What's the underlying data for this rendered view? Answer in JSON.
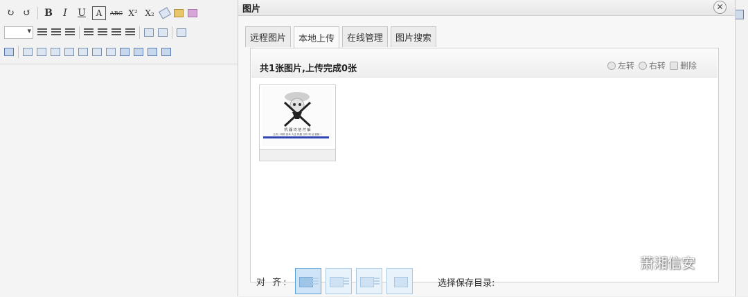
{
  "toolbar": {
    "row1": [
      {
        "name": "redo-icon",
        "glyph": "↻"
      },
      {
        "name": "undo-icon",
        "glyph": "↺"
      },
      {
        "name": "bold-icon",
        "glyph": "B"
      },
      {
        "name": "italic-icon",
        "glyph": "I"
      },
      {
        "name": "underline-icon",
        "glyph": "U"
      },
      {
        "name": "fontborder-icon",
        "glyph": "A"
      },
      {
        "name": "strikethrough-icon",
        "glyph": "ABC"
      },
      {
        "name": "superscript-icon",
        "glyph": "X²"
      },
      {
        "name": "subscript-icon",
        "glyph": "X₂"
      }
    ]
  },
  "dialog": {
    "title": "图片",
    "close_glyph": "✕",
    "tabs": [
      {
        "label": "远程图片"
      },
      {
        "label": "本地上传"
      },
      {
        "label": "在线管理"
      },
      {
        "label": "图片搜索"
      }
    ],
    "active_tab": "本地上传",
    "queue_info": "共1张图片,上传完成0张",
    "actions": {
      "rotate_left": "左转",
      "rotate_right": "右转",
      "delete": "删除"
    },
    "thumbnail": {
      "title_text": "机 器 均 信 付 解",
      "caption_text": "主页 | 网络 技术 大全 机器 分析 网 址 链接 1"
    },
    "align_label": "对 齐:",
    "save_dir_label": "选择保存目录:"
  },
  "watermark": {
    "text": "萧湘信安"
  }
}
